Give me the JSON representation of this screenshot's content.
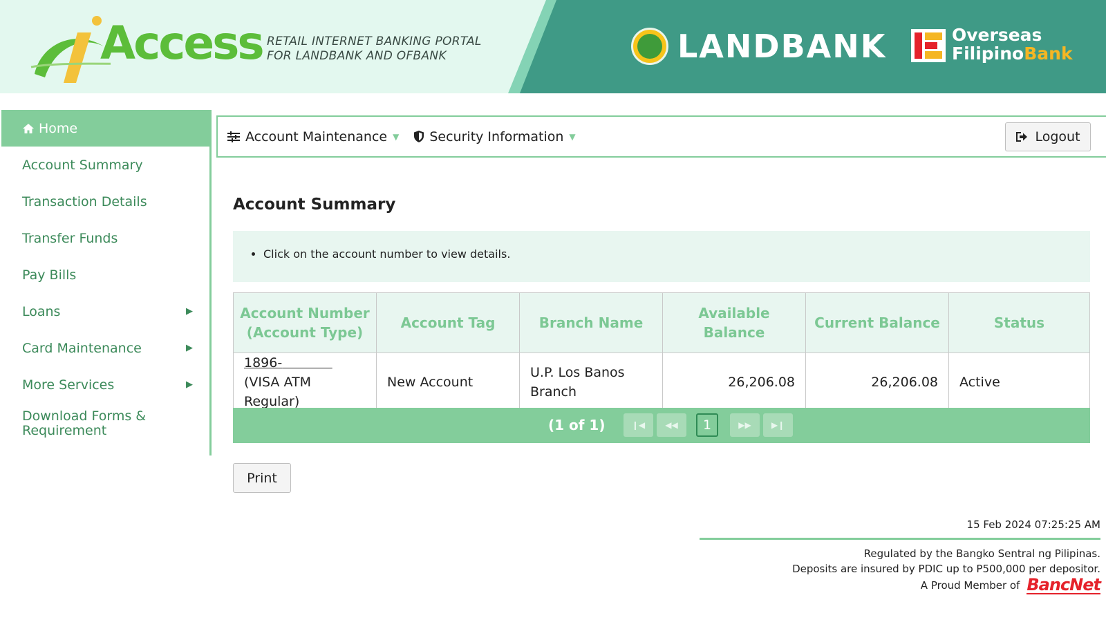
{
  "header": {
    "logo_text": "Access",
    "tagline_line1": "RETAIL INTERNET BANKING PORTAL",
    "tagline_line2": "FOR LANDBANK AND OFBANK",
    "landbank_text": "LANDBANK",
    "ofb_line1": "Overseas",
    "ofb_line2_a": "Filipino",
    "ofb_line2_b": "Bank"
  },
  "sidebar": {
    "items": [
      {
        "label": "Home",
        "icon": "home-icon",
        "active": true
      },
      {
        "label": "Account Summary"
      },
      {
        "label": "Transaction Details"
      },
      {
        "label": "Transfer Funds"
      },
      {
        "label": "Pay Bills"
      },
      {
        "label": "Loans",
        "submenu": true
      },
      {
        "label": "Card Maintenance",
        "submenu": true
      },
      {
        "label": "More Services",
        "submenu": true
      },
      {
        "label": "Download Forms & Requirement"
      }
    ]
  },
  "topnav": {
    "account_maintenance": "Account Maintenance",
    "security_information": "Security Information",
    "logout": "Logout"
  },
  "main": {
    "title": "Account Summary",
    "info": "Click on the account number to view details.",
    "table": {
      "headers": [
        "Account Number (Account Type)",
        "Account Tag",
        "Branch Name",
        "Available Balance",
        "Current Balance",
        "Status"
      ],
      "header_account_line1": "Account Number",
      "header_account_line2": "(Account Type)",
      "header_available_line1": "Available",
      "header_available_line2": "Balance",
      "rows": [
        {
          "account_number": "1896-",
          "account_type": "(VISA ATM Regular)",
          "account_tag": "New Account",
          "branch_line1": "U.P. Los Banos",
          "branch_line2": "Branch",
          "available_balance": "26,206.08",
          "current_balance": "26,206.08",
          "status": "Active"
        }
      ]
    },
    "pager": {
      "count": "(1 of 1)",
      "current_page": "1"
    },
    "print": "Print"
  },
  "footer": {
    "timestamp": "15 Feb 2024 07:25:25 AM",
    "regulated": "Regulated by the Bangko Sentral ng Pilipinas.",
    "insured": "Deposits are insured by PDIC up to P500,000 per depositor.",
    "member": "A Proud Member of",
    "bancnet": "BancNet"
  },
  "colors": {
    "accent_green": "#83cd9b",
    "header_teal": "#3f9a86",
    "bancnet_red": "#e5222b"
  }
}
